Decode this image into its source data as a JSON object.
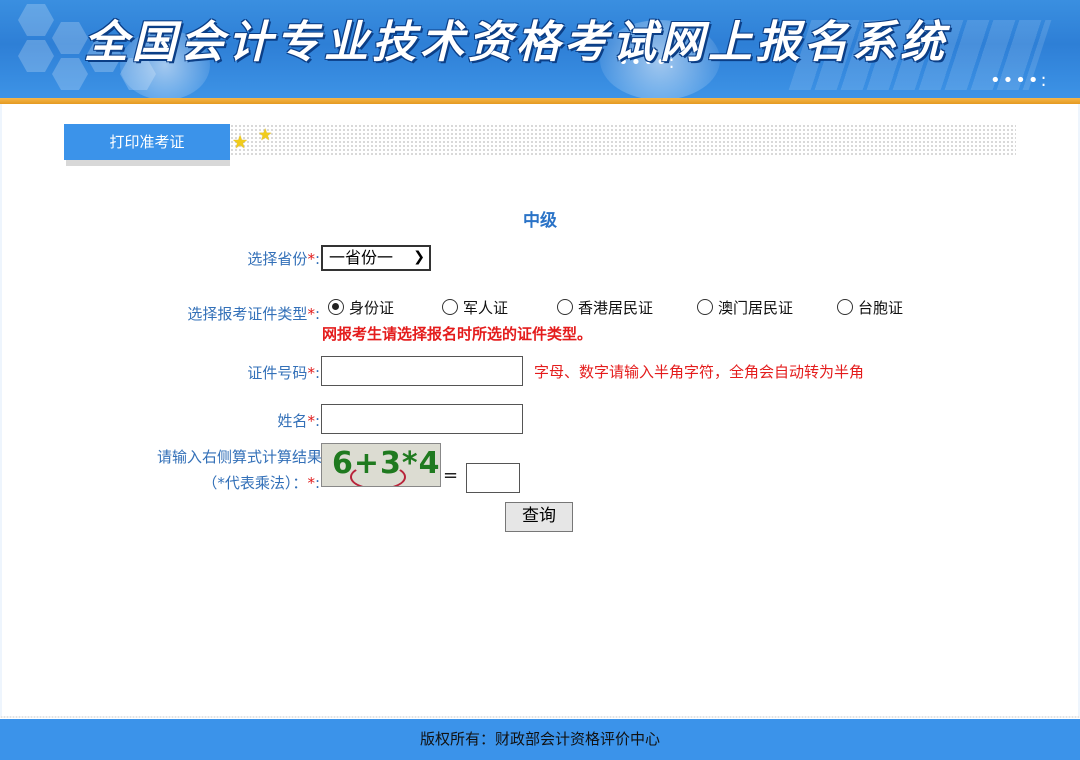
{
  "header": {
    "title": "全国会计专业技术资格考试网上报名系统"
  },
  "tabs": {
    "active_label": "打印准考证"
  },
  "form": {
    "level": "中级",
    "province_label": "选择省份",
    "required_mark": "*",
    "colon": ":",
    "province_selected": "一省份一",
    "id_type_label": "选择报考证件类型",
    "id_types": [
      "身份证",
      "军人证",
      "香港居民证",
      "澳门居民证",
      "台胞证"
    ],
    "id_type_selected_index": 0,
    "id_type_warning": "网报考生请选择报名时所选的证件类型。",
    "id_number_label": "证件号码",
    "id_number_value": "",
    "id_number_hint": "字母、数字请输入半角字符，全角会自动转为半角",
    "name_label": "姓名",
    "name_value": "",
    "captcha_label_line1": "请输入右侧算式计算结果",
    "captcha_label_line2": "（*代表乘法）：",
    "captcha_text": "6+3*4",
    "equals": "=",
    "captcha_answer": "",
    "query_button": "查询"
  },
  "footer": {
    "copyright": "版权所有：财政部会计资格评价中心"
  },
  "colors": {
    "brand_blue": "#3b93ea",
    "accent_orange": "#e49a21",
    "label_blue": "#3370b8",
    "warning_red": "#e41c1c"
  }
}
